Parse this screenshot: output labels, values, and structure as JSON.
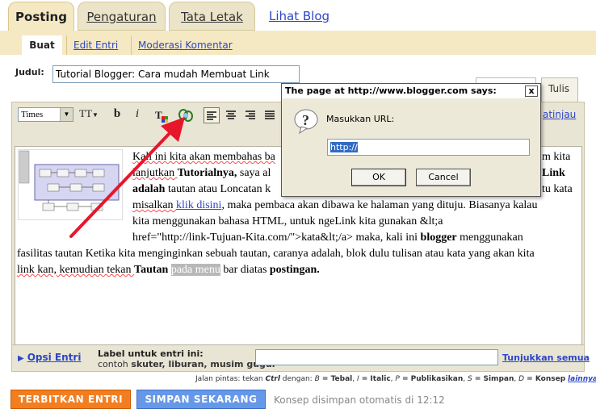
{
  "tabs": {
    "posting": "Posting",
    "pengaturan": "Pengaturan",
    "tata_letak": "Tata Letak",
    "lihat_blog": "Lihat Blog"
  },
  "subtabs": {
    "buat": "Buat",
    "edit_entri": "Edit Entri",
    "moderasi": "Moderasi Komentar"
  },
  "title_field": {
    "label": "Judul:",
    "value": "Tutorial Blogger: Cara mudah Membuat Link"
  },
  "editor_tabs": {
    "tulis": "Tulis"
  },
  "toolbar": {
    "font": "Times",
    "font_size_icon": "TT",
    "bold": "b",
    "italic": "i",
    "pratinjau": "atinjau"
  },
  "body": {
    "l1_a": "Kali ini kita akan membahas ba",
    "l1_b": "m kita",
    "l2_a": "lanjutkan ",
    "l2_b": "Tutorialnya,",
    "l2_c": " saya al",
    "l2_d": "Link",
    "l3_a": "adalah",
    "l3_b": " tautan atau Loncatan k",
    "l3_c": "tu kata",
    "l4_a": "misalkan ",
    "l4_b": "klik disini",
    "l4_c": ", maka pembaca akan dibawa ke halaman yang dituju. Biasanya kalau",
    "l5": "kita menggunakan bahasa HTML, untuk ngeLink kita gunakan &lt;a",
    "l6_a": "href=\"http://link-Tujuan-Kita.com/\">kata&lt;/a> maka, kali ini ",
    "l6_b": "blogger",
    "l6_c": " menggunakan",
    "l7": "fasilitas tautan Ketika kita menginginkan sebuah tautan, caranya adalah, blok dulu tulisan atau kata yang akan kita",
    "l8_a": "link kan, kemudian tekan ",
    "l8_b": "Tautan",
    "l8_c": " ",
    "l8_d": "pada menu",
    "l8_e": " bar diatas ",
    "l8_f": "postingan."
  },
  "options": {
    "opsi_entri": "Opsi Entri",
    "label_title": "Label untuk entri ini:",
    "label_example_prefix": "contoh ",
    "label_example_values": "skuter, liburan, musim gugur",
    "show_all": "Tunjukkan semua"
  },
  "shortcuts": {
    "prefix": "Jalan pintas:  tekan ",
    "ctrl": "Ctrl",
    "with": " dengan: ",
    "b_key": "B",
    "b_label": " = Tebal",
    "i_key": "I",
    "i_label": " = Italic",
    "p_key": "P",
    "p_label": " = Publikasikan",
    "s_key": "S",
    "s_label": " = Simpan",
    "d_key": "D",
    "d_label": " = Konsep",
    "more": "lainnya"
  },
  "actions": {
    "publish": "TERBITKAN ENTRI",
    "save": "SIMPAN SEKARANG",
    "autosave": "Konsep disimpan otomatis di 12:12"
  },
  "dialog": {
    "title": "The page at http://www.blogger.com says:",
    "close": "x",
    "prompt": "Masukkan URL:",
    "value": "http://",
    "ok": "OK",
    "cancel": "Cancel"
  },
  "colors": {
    "tab_bg": "#f5e9c4",
    "link": "#2b46c8",
    "publish": "#f37e1f",
    "save": "#6598e8",
    "arrow": "#e8162b"
  }
}
